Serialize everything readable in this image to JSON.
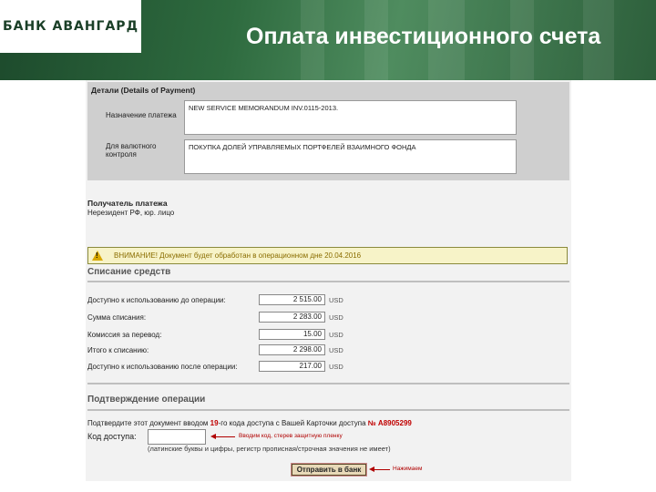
{
  "header": {
    "logo_text": "БАНК АВАНГАРД",
    "title": "Оплата инвестиционного счета"
  },
  "details": {
    "title": "Детали (Details of Payment)",
    "purpose_label": "Назначение платежа",
    "purpose_value": "NEW SERVICE MEMORANDUM INV.0115-2013.",
    "currency_control_label": "Для валютного контроля",
    "currency_control_value": "ПОКУПКА ДОЛЕЙ УПРАВЛЯЕМЫХ ПОРТФЕЛЕЙ ВЗАИМНОГО ФОНДА"
  },
  "recipient": {
    "title": "Получатель платежа",
    "subtitle": "Нерезидент РФ, юр. лицо"
  },
  "warning": {
    "text": "ВНИМАНИЕ! Документ будет обработан в операционном дне 20.04.2016"
  },
  "debit": {
    "title": "Списание средств",
    "rows": [
      {
        "label": "Доступно к использованию до операции:",
        "value": "2 515.00",
        "currency": "USD"
      },
      {
        "label": "Сумма списания:",
        "value": "2 283.00",
        "currency": "USD"
      },
      {
        "label": "Комиссия за перевод:",
        "value": "15.00",
        "currency": "USD"
      },
      {
        "label": "Итого к списанию:",
        "value": "2 298.00",
        "currency": "USD"
      },
      {
        "label": "Доступно к использованию после операции:",
        "value": "217.00",
        "currency": "USD"
      }
    ]
  },
  "confirm": {
    "title": "Подтверждение операции",
    "text_pre": "Подтвердите этот документ вводом",
    "code_index": "19",
    "text_mid": "-го кода доступа с Вашей Карточки доступа",
    "card_number": "№ A8905299",
    "code_label": "Код доступа:",
    "code_value": "",
    "code_hint": "(латинские буквы и цифры, регистр прописная/строчная значения не имеет)",
    "code_note": "Вводим код, стерев защитную пленку",
    "send_button": "Отправить в банк",
    "send_note": "Нажимаем"
  }
}
